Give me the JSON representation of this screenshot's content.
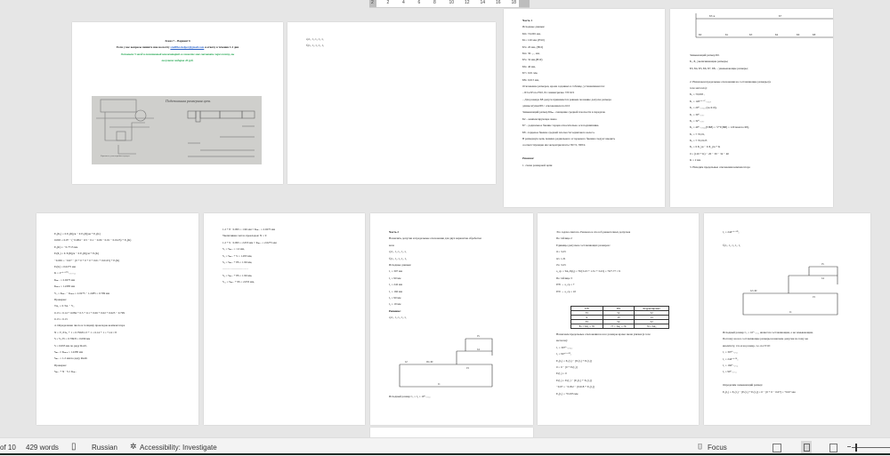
{
  "ruler": {
    "ticks": [
      "2",
      "2",
      "4",
      "6",
      "8",
      "10",
      "12",
      "14",
      "16",
      "18"
    ]
  },
  "pages": [
    {
      "id": "p1",
      "lines": [
        {
          "t": "Эскиз 7 – Вариант 6",
          "cls": "b c"
        },
        {
          "t": "Если у вас вопросы пишите мне на почту studfiles.helper@gmail.com я отвечу в течении 1-2 дня",
          "cls": "b c"
        },
        {
          "t": "Оставьте 5 звезд и позитивный комментарий и сможете мне скачивать через почту, вы",
          "cls": "green c"
        },
        {
          "t": "получите подарок 20 руб.",
          "cls": "green c"
        }
      ],
      "image_caption": "Подетальная размерная цепь",
      "drawing_caption": "Фрагмент узла коробки передач"
    },
    {
      "id": "p2",
      "lines": [
        {
          "t": "а) l₁, l₂, l₃, l₄, l₅"
        },
        {
          "t": "б) l₁, l₂, l₃, l₄, l₅"
        }
      ]
    },
    {
      "id": "p3",
      "lines": [
        {
          "t": "Часть 1",
          "cls": "b"
        },
        {
          "t": "Исходные данные:"
        },
        {
          "t": "Б0= ±0,065 мм,"
        },
        {
          "t": "Б1= 120 мм, (Н10)"
        },
        {
          "t": "Б3= 20 мм, (Н10)"
        },
        {
          "t": "Б4= 30₋₀.₁ мм,"
        },
        {
          "t": "Б5= 32 мм,(Н10)"
        },
        {
          "t": "Б6= 40 мм,"
        },
        {
          "t": "Б7= 0,01 мм,"
        },
        {
          "t": "Б8= 0,015 мм,"
        },
        {
          "t": "Отклонение размеров, кроме заданных в таблице, устанавливаются:"
        },
        {
          "t": "– Б3 и Б5 по Н10, Б1 симметрично ±IT10/2"
        },
        {
          "t": "– Для размера Б8 допуск принимается равным половине допуска размера"
        },
        {
          "t": "длины втулки Б8 с отклонением по h10"
        },
        {
          "t": "Замыкающий размер Б0ₘₐₓ смещение средней плоскости в передачи."
        },
        {
          "t": "Б2 – компенсирующее звено"
        },
        {
          "t": "Б7 – радиальное биение торцев относительно оси подшипника."
        },
        {
          "t": "Б8 –торцевое биение средней плоскости червячного колеса."
        },
        {
          "t": "В размерную цепь помимо радиального и торцового биения следует вводить"
        },
        {
          "t": "соответствующие им эксцентриситеты ±Б7/2, ±Б8/2."
        },
        {
          "t": ""
        },
        {
          "t": "Решение:",
          "cls": "b i"
        },
        {
          "t": "      1.   схема размерной цепи"
        }
      ]
    },
    {
      "id": "p4",
      "lines": [
        {
          "t": "Замыкающий размер Б0."
        },
        {
          "t": "Б₁, Б₂ увеличивающие размеры;"
        },
        {
          "t": "Б3, Б4, Б5, Б6, Б7, Б8, – уменьшающие размеры;"
        },
        {
          "t": ""
        },
        {
          "t": "      2.   Назначаем предельные отклонения на составляющие размеры (в"
        },
        {
          "t": "           теле металла):"
        },
        {
          "t": "Б₀ = ±0,065 ,"
        },
        {
          "t": "Б₁ = 120⁺⁰·⁰⁷₋₀.₀₇,"
        },
        {
          "t": "Б₃ = 20⁰₋₀.₀₈₄ (по h10),"
        },
        {
          "t": "Б₄ = 30⁰₋₀.₁,"
        },
        {
          "t": "Б₅ = 32⁰₋₀.₁,"
        },
        {
          "t": "Б₆ = 40⁰₋₀.₀₅₆(TIБ8) = ½*T(IБ8) = 120 мкм по h8),"
        },
        {
          "t": "Б₇ = ± ±0,01,"
        },
        {
          "t": "Б₈ = ± ±0,0125"
        },
        {
          "t": "Б₀ = Σ Б_ув − Σ Б_ум + K"
        },
        {
          "t": "0 = (120 + K) − 20 − 30 − 32 − 40"
        },
        {
          "t": "K = 2 мм"
        },
        {
          "t": "      3.   Находим предельные отклонения компенсатора"
        }
      ]
    },
    {
      "id": "p5",
      "lines": [
        {
          "t": "E₀(Б₀) = Σ E₀(Б)ув − Σ E₀(Б)ум + E₀(K)"
        },
        {
          "t": "0.065 = 0.07 − (−0.084 − 0.5 − 0.1 − 0.06 − 0.01 − 0.0125) + E₀(K)"
        },
        {
          "t": "E₀(K) = −0.7715 мм"
        },
        {
          "t": "Eᵢ(Б₀) = Σ Eᵢ(Б)ув − Σ E₀(Б)ум + Eᵢ(K)"
        },
        {
          "t": "−0.065 = −0.07 − (0 + 0 + 0 + 0 + 0.01 + 0.0125) + Eᵢ(K)"
        },
        {
          "t": "Eᵢ(K) = 0.0275 мм"
        },
        {
          "t": "K = 2⁺⁰·⁰²⁷⁵₋₀.₇₇₁₅"
        },
        {
          "t": "Kₘₐₓ = 2.0275 мм"
        },
        {
          "t": "Kₘᵢₙ = 1.2285 мм"
        },
        {
          "t": "V₀ = Kₘₐₓ − Kₘᵢₙ = 2.0275 − 1.2285 = 0.799 мм"
        },
        {
          "t": "Проверка:"
        },
        {
          "t": "TA₀ = Σ TAᵢ − V₀"
        },
        {
          "t": "0.13 = 0.14 + 0.084 + 0.5 + 0.1 + 0.06 + 0.02 + 0.025 − 0.799"
        },
        {
          "t": "0.13 = 0.13"
        },
        {
          "t": "      4.   Определение число и толщину прокладок компенсатора"
        },
        {
          "t": "N = V₀/TA₀ + 1 = 0.799/0.13 + 1 = 6.14 + 1 = 7.14 ≈ 8"
        },
        {
          "t": "S = V₀/N = 0.799/8 = 0.099 мм"
        },
        {
          "t": "S = 0.095 мм по ряду Ra10,"
        },
        {
          "t": "Sₘₐₓ ≥ Kₘᵢₙ = 1.2285 мм"
        },
        {
          "t": "Sₘₐₓ = 1.2 мм по ряду Ra40."
        },
        {
          "t": "Проверка:"
        },
        {
          "t": "Sₘₐₓ + N · S ≥ Kₘₐₓ"
        }
      ]
    },
    {
      "id": "p6",
      "lines": [
        {
          "t": "1.2 + 8 · 0.095 = 1.96 мм < Kₘₐₓ = 2.0275 мм"
        },
        {
          "t": "Увеличиваю число прокладок: N = 9"
        },
        {
          "t": "1.2 + 9 · 0.095 = 2.055 мм > Kₘₐₓ = 2.0275 мм"
        },
        {
          "t": "S₁ = Sₘₐₓ = 1.2 мм,"
        },
        {
          "t": "S₂ = Sₘₐₓ + S = 1.295 мм,"
        },
        {
          "t": "S₉ = Sₘₐₓ + 8S = 1.96 мм,"
        },
        {
          "t": "………………………"
        },
        {
          "t": "S₉ = Sₘₐₓ + 8S = 1.96 мм,"
        },
        {
          "t": "S₁₀ = Sₘₐₓ + 9S = 2.055 мм,"
        }
      ]
    },
    {
      "id": "p7",
      "lines": [
        {
          "t": "Часть 2",
          "cls": "b"
        },
        {
          "t": "Назначить допуски и предельные отклонения для двух вариантов обработки"
        },
        {
          "t": "вала"
        },
        {
          "t": "а) l₁, l₂, l₃, l₄, l₅"
        },
        {
          "t": "б) l₁, l₂, l₃, l₄, l₅"
        },
        {
          "t": "Исходные данные:"
        },
        {
          "t": "l₁ = 307 мм"
        },
        {
          "t": "l₂ = 90 мм"
        },
        {
          "t": "l₃ = 242 мм"
        },
        {
          "t": "l₄ = 160 мм"
        },
        {
          "t": "l₅ = 90 мм"
        },
        {
          "t": "l₆ = 19 мм"
        },
        {
          "t": "Решение:",
          "cls": "b"
        },
        {
          "t": "а) l₁, l₂, l₃, l₄, l₅"
        }
      ],
      "diagram": {
        "l5": "l5",
        "l4": "l4",
        "l2": "l2",
        "l6": "l6=l0",
        "l3": "l3",
        "l1": "l1"
      },
      "footer": "Исходный размер: l₀ = l₆ = 10⁰₋₀.₂₂"
    },
    {
      "id": "p8",
      "lines": [
        {
          "t": "Это задача синтеза. Решаем ее способ равноточных допусков"
        },
        {
          "t": "По таблице 2"
        },
        {
          "t": "Единицы допусков составляющих размеров:"
        },
        {
          "t": "i1= 3,23"
        },
        {
          "t": "i2= 1,31"
        },
        {
          "t": "i3= 3,23"
        },
        {
          "t": "a_ср = TA₀/Σ(iⱼ) = 70/(3.23 + 1.31 + 3.23) = 70/7.77 ≈ 9"
        },
        {
          "t": "По таблице 3"
        },
        {
          "t": "IT8 → a_ср = 7"
        },
        {
          "t": "IT9 → a_ср = 10"
        }
      ],
      "table": {
        "headers": [
          "IT8",
          "IT9",
          "Корректировка"
        ],
        "rows": [
          [
            "33",
            "52",
            "52"
          ],
          [
            "9",
            "13",
            "13"
          ],
          [
            "33",
            "52",
            "52"
          ],
          [
            "81 < TA₀ = 70",
            "77 > TA₀ = 70",
            "70 = TA₀"
          ]
        ]
      },
      "lines2": [
        {
          "t": "Назначаем предельные отклонения на все размеры кроме звена увязки (в теле"
        },
        {
          "t": "металла):"
        },
        {
          "t": "l₁ = 307⁰₋₀.₀₅₂"
        },
        {
          "t": "l₂ = 90⁺⁰·⁰¹³₀"
        },
        {
          "t": "E₀(l₀) = E₀(l₁) − [Eᵢ(l₂) + Eᵢ(l₃)]"
        },
        {
          "t": "0 = 0 − [0 + Eᵢ(l₃)]"
        },
        {
          "t": "Eᵢ(l₃) = 0"
        },
        {
          "t": "Eᵢ(l₀) = Eᵢ(l₁) − [E₀(l₂) + E₀(l₃)]"
        },
        {
          "t": "−0.07 = −0.052 − [0.018 + E₀(l₃)]"
        },
        {
          "t": "E₀(l₃) = +0.035 мм"
        }
      ]
    },
    {
      "id": "p9",
      "lines": [
        {
          "t": "l₃ = 242⁺⁰·⁰³⁵₀"
        },
        {
          "t": ""
        },
        {
          "t": "б) l₁, l₂, l₃, l₄, l₅"
        }
      ],
      "diagram": {
        "l5": "l5",
        "l4": "l4",
        "l2": "l2=l0",
        "l3": "l3",
        "l1": "l1"
      },
      "lines2": [
        {
          "t": "Исходный размер: l₀ = 10⁰₋₀.₂₂ является составляющим, а не замыкающим."
        },
        {
          "t": "Поэтому на все составляющие размеры назначаем допуски по тому же"
        },
        {
          "t": "квалитету, что и на размер, т.е. по IT10:"
        },
        {
          "t": "l₁ = 307⁰₋₀.₂₁"
        },
        {
          "t": "l₂ = 242⁺⁰·¹⁸₀"
        },
        {
          "t": "l₃ = 160⁰₋₀.₁₆"
        },
        {
          "t": "l₅ = 90⁰₋₀.₁₄"
        },
        {
          "t": ""
        },
        {
          "t": "Определим замыкающий размер:"
        },
        {
          "t": "E₀(l₂) = E₀(l₁) − [Eᵢ(l₂) + Eᵢ(l₃)] = 0 − [0 + 0 − 0.07] = +0.07 мм"
        }
      ]
    }
  ],
  "status": {
    "page_info": "of 10",
    "words": "429 words",
    "language": "Russian",
    "accessibility": "Accessibility: Investigate",
    "focus": "Focus"
  }
}
